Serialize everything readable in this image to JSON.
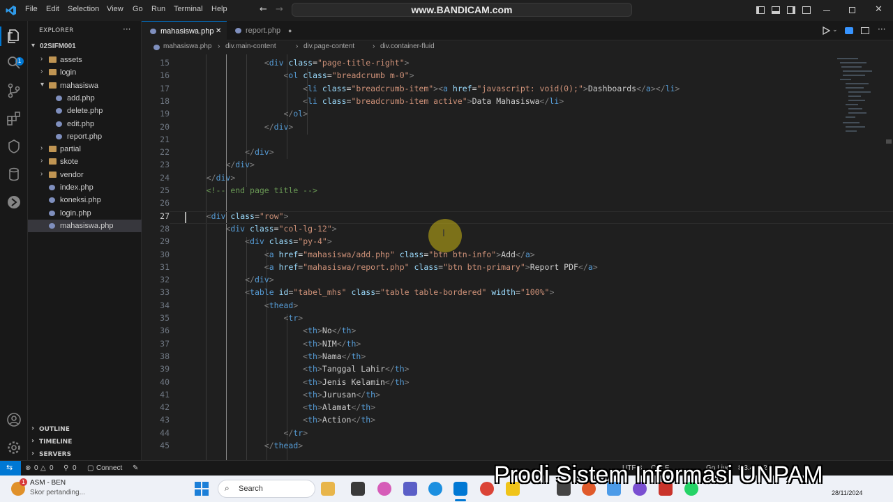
{
  "titlebar": {
    "menu": [
      "File",
      "Edit",
      "Selection",
      "View",
      "Go",
      "Run",
      "Terminal",
      "Help"
    ],
    "command_center": "www.BANDICAM.com"
  },
  "activity": {
    "icons": [
      "files-icon",
      "search-icon",
      "source-control-icon",
      "extensions-icon",
      "testing-icon",
      "database-icon",
      "remote-icon",
      "account-icon",
      "gear-icon"
    ],
    "badge": "1"
  },
  "sidebar": {
    "title": "EXPLORER",
    "more": "···",
    "root": "02SIFM001",
    "items": [
      {
        "label": "assets",
        "kind": "folder",
        "depth": 1,
        "open": false
      },
      {
        "label": "login",
        "kind": "folder",
        "depth": 1,
        "open": false
      },
      {
        "label": "mahasiswa",
        "kind": "folder",
        "depth": 1,
        "open": true
      },
      {
        "label": "add.php",
        "kind": "php",
        "depth": 2
      },
      {
        "label": "delete.php",
        "kind": "php",
        "depth": 2
      },
      {
        "label": "edit.php",
        "kind": "php",
        "depth": 2
      },
      {
        "label": "report.php",
        "kind": "php",
        "depth": 2
      },
      {
        "label": "partial",
        "kind": "folder",
        "depth": 1,
        "open": false
      },
      {
        "label": "skote",
        "kind": "folder",
        "depth": 1,
        "open": false
      },
      {
        "label": "vendor",
        "kind": "folder",
        "depth": 1,
        "open": false
      },
      {
        "label": "index.php",
        "kind": "php",
        "depth": 1
      },
      {
        "label": "koneksi.php",
        "kind": "php",
        "depth": 1
      },
      {
        "label": "login.php",
        "kind": "php",
        "depth": 1
      },
      {
        "label": "mahasiswa.php",
        "kind": "php",
        "depth": 1,
        "selected": true
      }
    ],
    "sections": [
      "OUTLINE",
      "TIMELINE",
      "SERVERS"
    ]
  },
  "tabs": [
    {
      "label": "mahasiswa.php",
      "active": true,
      "close": "✕"
    },
    {
      "label": "report.php",
      "active": false,
      "dirty": "●"
    }
  ],
  "breadcrumbs": [
    "mahasiswa.php",
    "div.main-content",
    "div.page-content",
    "div.container-fluid"
  ],
  "editor": {
    "current_line": 27,
    "lines": [
      {
        "n": 15,
        "html": "                <span class='t'>&lt;</span><span class='n'>div</span> <span class='a'>class</span>=<span class='s'>\"page-title-right\"</span><span class='t'>&gt;</span>"
      },
      {
        "n": 16,
        "html": "                    <span class='t'>&lt;</span><span class='n'>ol</span> <span class='a'>class</span>=<span class='s'>\"breadcrumb m-0\"</span><span class='t'>&gt;</span>"
      },
      {
        "n": 17,
        "html": "                        <span class='t'>&lt;</span><span class='n'>li</span> <span class='a'>class</span>=<span class='s'>\"breadcrumb-item\"</span><span class='t'>&gt;&lt;</span><span class='n'>a</span> <span class='a'>href</span>=<span class='s'>\"javascript: void(0);\"</span><span class='t'>&gt;</span>Dashboards<span class='t'>&lt;/</span><span class='n'>a</span><span class='t'>&gt;&lt;/</span><span class='n'>li</span><span class='t'>&gt;</span>"
      },
      {
        "n": 18,
        "html": "                        <span class='t'>&lt;</span><span class='n'>li</span> <span class='a'>class</span>=<span class='s'>\"breadcrumb-item active\"</span><span class='t'>&gt;</span>Data Mahasiswa<span class='t'>&lt;/</span><span class='n'>li</span><span class='t'>&gt;</span>"
      },
      {
        "n": 19,
        "html": "                    <span class='t'>&lt;/</span><span class='n'>ol</span><span class='t'>&gt;</span>"
      },
      {
        "n": 20,
        "html": "                <span class='t'>&lt;/</span><span class='n'>div</span><span class='t'>&gt;</span>"
      },
      {
        "n": 21,
        "html": ""
      },
      {
        "n": 22,
        "html": "            <span class='t'>&lt;/</span><span class='n'>div</span><span class='t'>&gt;</span>"
      },
      {
        "n": 23,
        "html": "        <span class='t'>&lt;/</span><span class='n'>div</span><span class='t'>&gt;</span>"
      },
      {
        "n": 24,
        "html": "    <span class='t'>&lt;/</span><span class='n'>div</span><span class='t'>&gt;</span>"
      },
      {
        "n": 25,
        "html": "    <span class='c'>&lt;!-- end page title --&gt;</span>"
      },
      {
        "n": 26,
        "html": ""
      },
      {
        "n": 27,
        "html": "    <span class='t'>&lt;</span><span class='n'>div</span> <span class='a'>class</span>=<span class='s'>\"row\"</span><span class='t'>&gt;</span>"
      },
      {
        "n": 28,
        "html": "        <span class='t'>&lt;</span><span class='n'>div</span> <span class='a'>class</span>=<span class='s'>\"col-lg-12\"</span><span class='t'>&gt;</span>"
      },
      {
        "n": 29,
        "html": "            <span class='t'>&lt;</span><span class='n'>div</span> <span class='a'>class</span>=<span class='s'>\"py-4\"</span><span class='t'>&gt;</span>"
      },
      {
        "n": 30,
        "html": "                <span class='t'>&lt;</span><span class='n'>a</span> <span class='a'>href</span>=<span class='s'>\"mahasiswa/add.php\"</span> <span class='a'>class</span>=<span class='s'>\"btn btn-info\"</span><span class='t'>&gt;</span>Add<span class='t'>&lt;/</span><span class='n'>a</span><span class='t'>&gt;</span>"
      },
      {
        "n": 31,
        "html": "                <span class='t'>&lt;</span><span class='n'>a</span> <span class='a'>href</span>=<span class='s'>\"mahasiswa/report.php\"</span> <span class='a'>class</span>=<span class='s'>\"btn btn-primary\"</span><span class='t'>&gt;</span>Report PDF<span class='t'>&lt;/</span><span class='n'>a</span><span class='t'>&gt;</span>"
      },
      {
        "n": 32,
        "html": "            <span class='t'>&lt;/</span><span class='n'>div</span><span class='t'>&gt;</span>"
      },
      {
        "n": 33,
        "html": "            <span class='t'>&lt;</span><span class='n'>table</span> <span class='a'>id</span>=<span class='s'>\"tabel_mhs\"</span> <span class='a'>class</span>=<span class='s'>\"table table-bordered\"</span> <span class='a'>width</span>=<span class='s'>\"100%\"</span><span class='t'>&gt;</span>"
      },
      {
        "n": 34,
        "html": "                <span class='t'>&lt;</span><span class='n'>thead</span><span class='t'>&gt;</span>"
      },
      {
        "n": 35,
        "html": "                    <span class='t'>&lt;</span><span class='n'>tr</span><span class='t'>&gt;</span>"
      },
      {
        "n": 36,
        "html": "                        <span class='t'>&lt;</span><span class='n'>th</span><span class='t'>&gt;</span>No<span class='t'>&lt;/</span><span class='n'>th</span><span class='t'>&gt;</span>"
      },
      {
        "n": 37,
        "html": "                        <span class='t'>&lt;</span><span class='n'>th</span><span class='t'>&gt;</span>NIM<span class='t'>&lt;/</span><span class='n'>th</span><span class='t'>&gt;</span>"
      },
      {
        "n": 38,
        "html": "                        <span class='t'>&lt;</span><span class='n'>th</span><span class='t'>&gt;</span>Nama<span class='t'>&lt;/</span><span class='n'>th</span><span class='t'>&gt;</span>"
      },
      {
        "n": 39,
        "html": "                        <span class='t'>&lt;</span><span class='n'>th</span><span class='t'>&gt;</span>Tanggal Lahir<span class='t'>&lt;/</span><span class='n'>th</span><span class='t'>&gt;</span>"
      },
      {
        "n": 40,
        "html": "                        <span class='t'>&lt;</span><span class='n'>th</span><span class='t'>&gt;</span>Jenis Kelamin<span class='t'>&lt;/</span><span class='n'>th</span><span class='t'>&gt;</span>"
      },
      {
        "n": 41,
        "html": "                        <span class='t'>&lt;</span><span class='n'>th</span><span class='t'>&gt;</span>Jurusan<span class='t'>&lt;/</span><span class='n'>th</span><span class='t'>&gt;</span>"
      },
      {
        "n": 42,
        "html": "                        <span class='t'>&lt;</span><span class='n'>th</span><span class='t'>&gt;</span>Alamat<span class='t'>&lt;/</span><span class='n'>th</span><span class='t'>&gt;</span>"
      },
      {
        "n": 43,
        "html": "                        <span class='t'>&lt;</span><span class='n'>th</span><span class='t'>&gt;</span>Action<span class='t'>&lt;/</span><span class='n'>th</span><span class='t'>&gt;</span>"
      },
      {
        "n": 44,
        "html": "                    <span class='t'>&lt;/</span><span class='n'>tr</span><span class='t'>&gt;</span>"
      },
      {
        "n": 45,
        "html": "                <span class='t'>&lt;/</span><span class='n'>thead</span><span class='t'>&gt;</span>"
      }
    ]
  },
  "statusbar": {
    "errors": "0",
    "warnings": "0",
    "ports": "0",
    "connect": "Connect",
    "encoding": "UTF-8",
    "eol": "CRLF",
    "golive": "Go Live",
    "version": "8.3.4: 8.2"
  },
  "taskbar": {
    "notification_title": "ASM - BEN",
    "notification_sub": "Skor pertanding...",
    "notification_badge": "1",
    "search_label": "Search",
    "date": "28/11/2024"
  },
  "watermark": "Prodi Sistem Informasi UNPAM"
}
